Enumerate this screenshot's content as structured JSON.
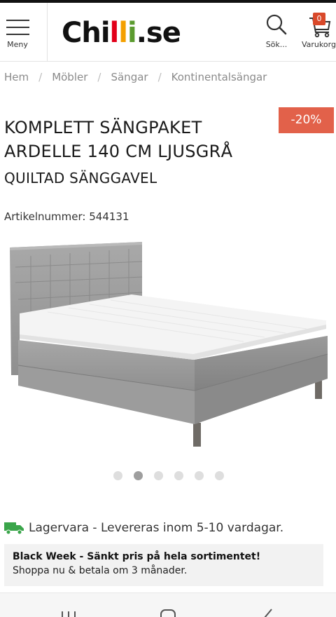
{
  "header": {
    "menu_label": "Meny",
    "logo": {
      "part1": "Chi",
      "l1": "l",
      "l2": "l",
      "i": "i",
      "part2": ".se"
    },
    "search_label": "Sök...",
    "cart_label": "Varukorg",
    "cart_count": "0"
  },
  "breadcrumb": [
    "Hem",
    "Möbler",
    "Sängar",
    "Kontinentalsängar"
  ],
  "product": {
    "title": "KOMPLETT SÄNGPAKET ARDELLE 140 CM LJUSGRÅ",
    "subtitle": "QUILTAD SÄNGGAVEL",
    "discount": "-20%",
    "article_label": "Artikelnummer:",
    "article_number": "544131"
  },
  "gallery": {
    "count": 6,
    "active_index": 1
  },
  "stock": {
    "text": "Lagervara - Levereras inom 5-10 vardagar."
  },
  "promo": {
    "title": "Black Week - Sänkt pris på hela sortimentet!",
    "text": "Shoppa nu & betala om 3 månader."
  },
  "colors": {
    "discount_badge": "#e2614a",
    "cart_badge": "#d9492a",
    "truck": "#3aa54a",
    "logo_red": "#e2001a",
    "logo_orange": "#f4a000",
    "logo_green": "#5b9b2f"
  }
}
